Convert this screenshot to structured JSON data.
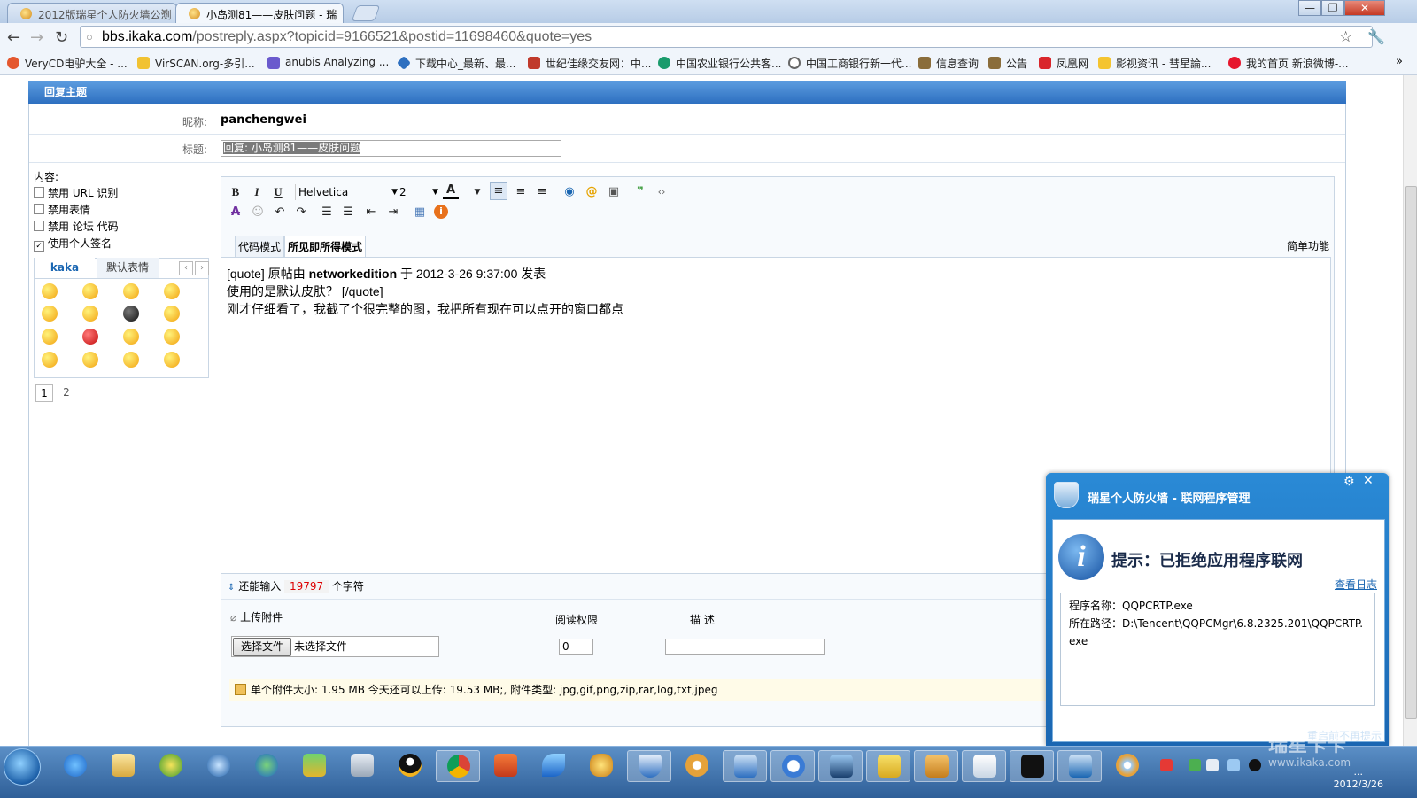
{
  "browser": {
    "tabs": [
      {
        "title": "2012版瑞星个人防火墙公测"
      },
      {
        "title": "小岛测81——皮肤问题 - 瑞"
      }
    ],
    "url_host": "bbs.ikaka.com",
    "url_path": "/postreply.aspx?topicid=9166521&postid=11698460&quote=yes",
    "window_buttons": {
      "minimize": "—",
      "restore": "❐",
      "close": "✕"
    },
    "bookmarks": [
      "VeryCD电驴大全 - ...",
      "VirSCAN.org-多引...",
      "anubis Analyzing ...",
      "下载中心_最新、最...",
      "世纪佳缘交友网：中...",
      "中国农业银行公共客...",
      "中国工商银行新一代...",
      "信息查询",
      "公告",
      "凤凰网",
      "影视资讯 - 彗星論...",
      "我的首页 新浪微博-..."
    ],
    "more_bookmarks": "»"
  },
  "form": {
    "header": "回复主题",
    "nickname_label": "昵称:",
    "nickname": "panchengwei",
    "subject_label": "标题:",
    "subject_value": "回复: 小岛测81——皮肤问题",
    "content_label": "内容:",
    "options": [
      {
        "label": "禁用 URL 识别",
        "checked": false
      },
      {
        "label": "禁用表情",
        "checked": false
      },
      {
        "label": "禁用 论坛 代码",
        "checked": false
      },
      {
        "label": "使用个人签名",
        "checked": true
      }
    ],
    "emoji_tabs": [
      "kaka",
      "默认表情"
    ],
    "pages": [
      "1",
      "2"
    ]
  },
  "editor": {
    "font": "Helvetica",
    "size": "2",
    "mode_code": "代码模式",
    "mode_wysiwyg": "所见即所得模式",
    "simple_mode": "简单功能",
    "lines": [
      "[quote] 原帖由 ",
      "networkedition",
      " 于 2012-3-26 9:37:00 发表",
      "使用的是默认皮肤？ [/quote]",
      "刚才仔细看了，我截了个很完整的图，我把所有现在可以点开的窗口都点"
    ],
    "remain_prefix": "还能输入",
    "remain_count": "19797",
    "remain_suffix": "个字符"
  },
  "attachment": {
    "upload_label": "上传附件",
    "permission_label": "阅读权限",
    "desc_label": "描 述",
    "choose_button": "选择文件",
    "no_file": "未选择文件",
    "permission_value": "0",
    "info": "单个附件大小: 1.95 MB  今天还可以上传: 19.53 MB;,  附件类型: jpg,gif,png,zip,rar,log,txt,jpeg"
  },
  "popup": {
    "title": "瑞星个人防火墙 - 联网程序管理",
    "message": "提示：已拒绝应用程序联网",
    "view_log": "查看日志",
    "program_label": "程序名称：",
    "program_name": "QQPCRTP.exe",
    "path_label": "所在路径：",
    "path": "D:\\Tencent\\QQPCMgr\\6.8.2325.201\\QQPCRTP.exe",
    "footer": "重启前不再提示"
  },
  "taskbar": {
    "time": "...",
    "date": "2012/3/26"
  },
  "watermark": {
    "brand": "瑞星卡卡",
    "site": "www.ikaka.com"
  }
}
